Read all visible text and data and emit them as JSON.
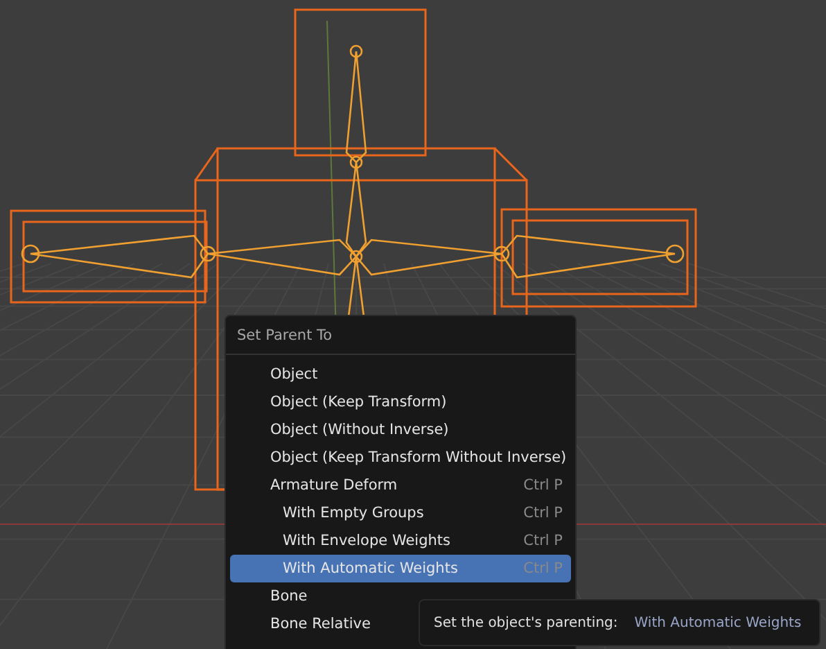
{
  "menu": {
    "title": "Set Parent To",
    "items": [
      {
        "label": "Object",
        "selected": false
      },
      {
        "label": "Object (Keep Transform)",
        "selected": false
      },
      {
        "label": "Object (Without Inverse)",
        "selected": false
      },
      {
        "label": "Object (Keep Transform Without Inverse)",
        "selected": false
      },
      {
        "label": "Armature Deform",
        "shortcut": "Ctrl P",
        "selected": false,
        "children": [
          {
            "label": "With Empty Groups",
            "shortcut": "Ctrl P",
            "selected": false
          },
          {
            "label": "With Envelope Weights",
            "shortcut": "Ctrl P",
            "selected": false
          },
          {
            "label": "With Automatic Weights",
            "shortcut": "Ctrl P",
            "selected": true
          }
        ]
      },
      {
        "label": "Bone",
        "selected": false
      },
      {
        "label": "Bone Relative",
        "selected": false
      }
    ]
  },
  "tooltip": {
    "text": "Set the object's parenting:",
    "value": "With Automatic Weights"
  }
}
